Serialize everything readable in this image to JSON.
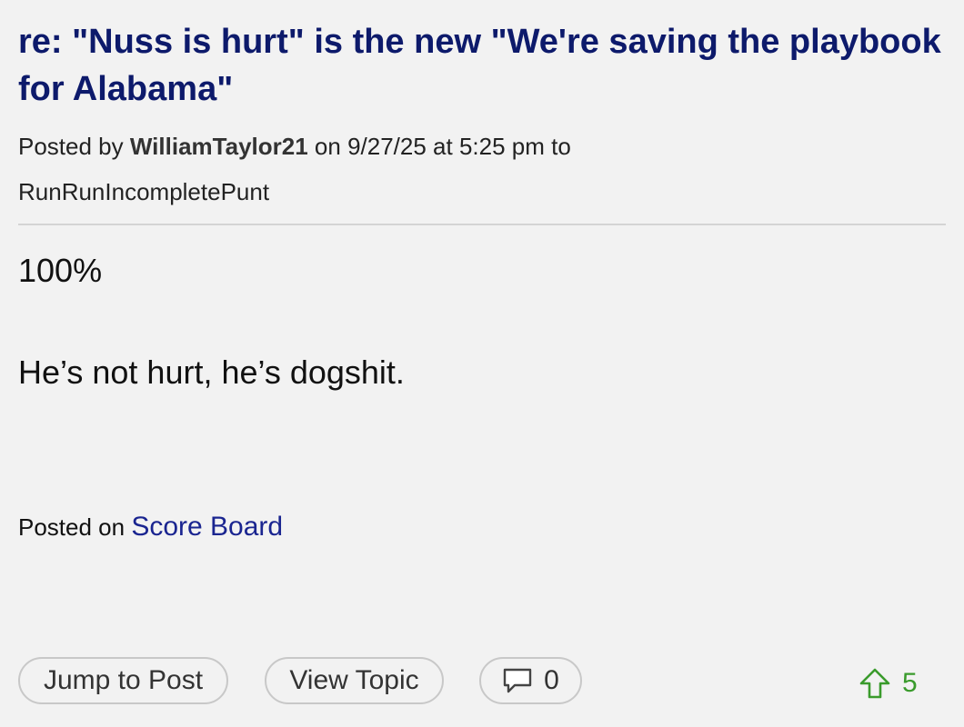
{
  "post": {
    "title": "re: \"Nuss is hurt\" is the new \"We're saving the playbook for Alabama\"",
    "meta": {
      "posted_by_label": "Posted by",
      "author": "WilliamTaylor21",
      "on_label": "on",
      "timestamp": "9/27/25 at 5:25 pm",
      "to_label": "to",
      "recipient": "RunRunIncompletePunt"
    },
    "body": {
      "line1": "100%",
      "line2": "He’s not hurt, he’s dogshit."
    },
    "posted_on": {
      "label": "Posted on",
      "board": "Score Board"
    }
  },
  "actions": {
    "jump_to_post": "Jump to Post",
    "view_topic": "View Topic",
    "reply_count": "0",
    "reply_icon": "speech-bubble-icon",
    "upvote_icon": "up-arrow-icon",
    "upvote_count": "5"
  },
  "colors": {
    "title": "#0d1a6b",
    "link": "#1a2590",
    "upvote": "#3a9b2c",
    "background": "#f2f2f2"
  }
}
